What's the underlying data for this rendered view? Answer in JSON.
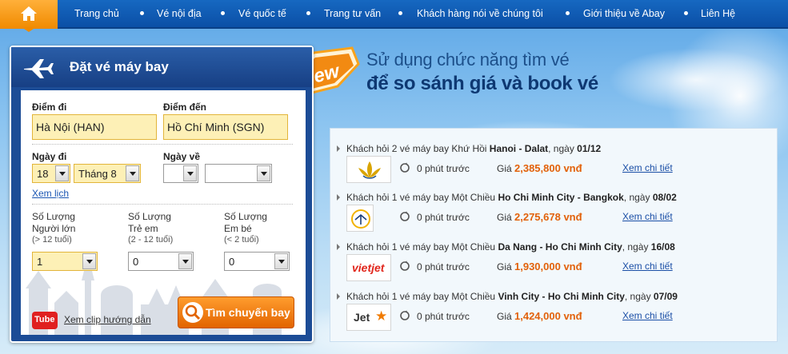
{
  "nav": {
    "items": [
      {
        "label": "Trang chủ"
      },
      {
        "label": "Vé nội địa"
      },
      {
        "label": "Vé quốc tế"
      },
      {
        "label": "Trang tư vấn"
      },
      {
        "label": "Khách hàng nói về chúng tôi"
      },
      {
        "label": "Giới thiệu về Abay"
      },
      {
        "label": "Liên Hệ"
      }
    ]
  },
  "promo": {
    "badge": "New",
    "line1": "Sử dụng chức năng tìm vé",
    "line2": "để so sánh giá và book vé"
  },
  "booking": {
    "title": "Đặt vé máy bay",
    "from_label": "Điểm đi",
    "from_value": "Hà Nội (HAN)",
    "to_label": "Điểm đến",
    "to_value": "Hồ Chí Minh (SGN)",
    "depart_label": "Ngày đi",
    "depart_day": "18",
    "depart_month": "Tháng 8",
    "return_label": "Ngày về",
    "return_day": "",
    "return_month": "",
    "calendar_link": "Xem lịch",
    "adults": {
      "label1": "Số Lượng",
      "label2": "Người lớn",
      "hint": "(> 12 tuổi)",
      "value": "1"
    },
    "children": {
      "label1": "Số Lượng",
      "label2": "Trẻ em",
      "hint": "(2 - 12 tuổi)",
      "value": "0"
    },
    "infants": {
      "label1": "Số Lượng",
      "label2": "Em bé",
      "hint": "(< 2 tuổi)",
      "value": "0"
    },
    "youtube_label": "Tube",
    "guide_link": "Xem clip hướng dẫn",
    "search_button": "Tìm chuyến bay"
  },
  "results": [
    {
      "prefix": "Khách hỏi 2 vé máy bay Khứ Hồi ",
      "route": "Hanoi - Dalat",
      "date_prefix": ", ngày ",
      "date": "01/12",
      "airline_icon": "vietnam-airlines-logo",
      "ago": "0 phút trước",
      "price_label": "Giá",
      "price": "2,385,800 vnđ",
      "link": "Xem chi tiết"
    },
    {
      "prefix": "Khách hỏi 1 vé máy bay Một Chiều ",
      "route": "Ho Chi Minh City - Bangkok",
      "date_prefix": ", ngày ",
      "date": "08/02",
      "airline_icon": "lufthansa-logo",
      "ago": "0 phút trước",
      "price_label": "Giá",
      "price": "2,275,678 vnđ",
      "link": "Xem chi tiết"
    },
    {
      "prefix": "Khách hỏi 1 vé máy bay Một Chiều ",
      "route": "Da Nang - Ho Chi Minh City",
      "date_prefix": ", ngày ",
      "date": "16/08",
      "airline_icon": "vietjet-logo",
      "airline_text": "vietjet",
      "ago": "0 phút trước",
      "price_label": "Giá",
      "price": "1,930,000 vnđ",
      "link": "Xem chi tiết"
    },
    {
      "prefix": "Khách hỏi 1 vé máy bay Một Chiều ",
      "route": "Vinh City - Ho Chi Minh City",
      "date_prefix": ", ngày ",
      "date": "07/09",
      "airline_icon": "jetstar-logo",
      "airline_text": "Jet",
      "ago": "0 phút trước",
      "price_label": "Giá",
      "price": "1,424,000 vnđ",
      "link": "Xem chi tiết"
    }
  ],
  "colors": {
    "nav_bg": "#0b4fa6",
    "home_orange": "#f08a00",
    "price_orange": "#e2610a",
    "link_blue": "#1b4fa6",
    "widget_blue": "#1c4c96"
  }
}
